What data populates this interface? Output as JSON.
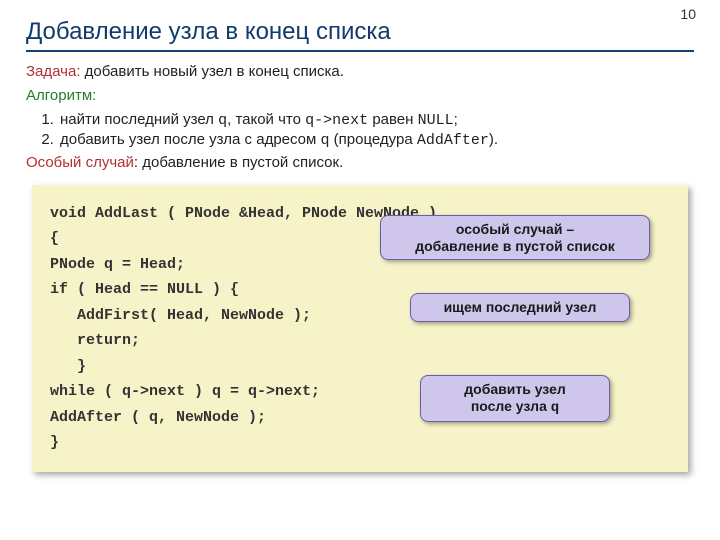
{
  "page_number": "10",
  "title": "Добавление узла в конец списка",
  "task_label": "Задача:",
  "task_text": " добавить новый узел в конец списка.",
  "algo_label": "Алгоритм:",
  "steps": {
    "s1_a": "найти последний узел ",
    "s1_q": "q",
    "s1_b": ", такой что ",
    "s1_qnext": "q->next",
    "s1_c": " равен ",
    "s1_null": "NULL",
    "s1_d": ";",
    "s2_a": "добавить узел после узла с адресом ",
    "s2_q": "q",
    "s2_b": " (процедура ",
    "s2_proc": "AddAfter",
    "s2_c": ")."
  },
  "special_label": "Особый случай",
  "special_text": ": добавление в пустой список.",
  "code": {
    "l1": "void AddLast ( PNode &Head, PNode NewNode )",
    "l2": "{",
    "l3": "PNode q = Head;",
    "l4": "if ( Head == NULL ) {",
    "l5": "   AddFirst( Head, NewNode );",
    "l6": "   return;",
    "l7": "   }",
    "l8": "while ( q->next ) q = q->next;",
    "l9": "AddAfter ( q, NewNode );",
    "l10": "}"
  },
  "callouts": {
    "c1_a": "особый случай –",
    "c1_b": "добавление в пустой список",
    "c2": "ищем последний узел",
    "c3_a": "добавить узел",
    "c3_b_a": "после узла ",
    "c3_b_q": "q"
  }
}
